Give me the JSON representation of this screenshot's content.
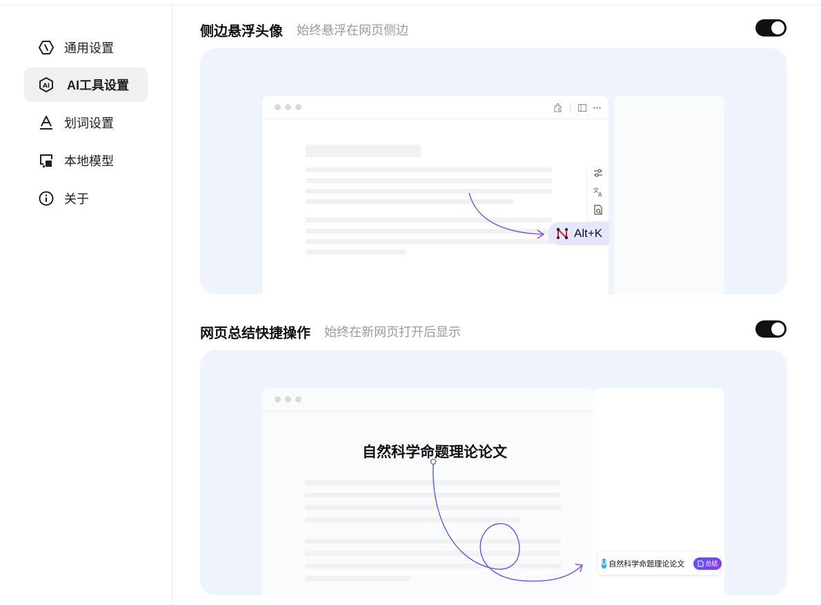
{
  "sidebar": {
    "items": [
      {
        "label": "通用设置",
        "icon": "general-settings-icon",
        "active": false
      },
      {
        "label": "AI工具设置",
        "icon": "ai-tools-icon",
        "active": true
      },
      {
        "label": "划词设置",
        "icon": "text-selection-icon",
        "active": false
      },
      {
        "label": "本地模型",
        "icon": "local-model-icon",
        "active": false
      },
      {
        "label": "关于",
        "icon": "info-icon",
        "active": false
      }
    ]
  },
  "sections": [
    {
      "title": "侧边悬浮头像",
      "description": "始终悬浮在网页侧边",
      "enabled": true,
      "preview": {
        "shortcut_label": "Alt+K"
      }
    },
    {
      "title": "网页总结快捷操作",
      "description": "始终在新网页打开后显示",
      "enabled": true,
      "preview": {
        "doc_title": "自然科学命题理论论文",
        "card_title": "自然科学命题理论论文",
        "summary_button": "总结"
      }
    }
  ],
  "colors": {
    "toggle_on": "#111111",
    "panel_bg": "#eff4fc",
    "accent_purple": "#7b3ff2",
    "accent_blue": "#4a5cf0"
  }
}
